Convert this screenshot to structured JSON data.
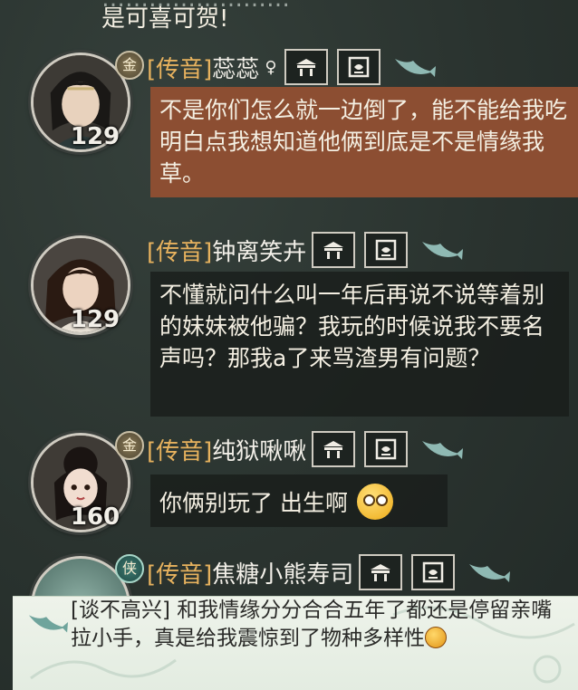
{
  "top_message": {
    "line1": "……………………",
    "line2": "是可喜可贺!"
  },
  "messages": [
    {
      "channel": "[传音]",
      "username": "蕊蕊",
      "gender_icon": "female-symbol",
      "gender_text": "♀",
      "rank_badge": "金",
      "level": "129",
      "text": "不是你们怎么就一边倒了，能不能给我吃明白点我想知道他俩到底是不是情缘我草。",
      "highlighted": true,
      "icons": [
        "house-icon",
        "profile-card-icon",
        "fish-icon"
      ]
    },
    {
      "channel": "[传音]",
      "username": "钟离笑卉",
      "rank_badge": "",
      "level": "129",
      "text": "不懂就问什么叫一年后再说不说等着别的妹妹被他骗？我玩的时候说我不要名声吗？那我a了来骂渣男有问题？",
      "highlighted": false,
      "icons": [
        "house-icon",
        "profile-card-icon",
        "fish-icon"
      ]
    },
    {
      "channel": "[传音]",
      "username": "纯狱啾啾",
      "rank_badge": "金",
      "level": "160",
      "text": "你俩别玩了 出生啊",
      "emoji": "rolling-eyes-emoji",
      "highlighted": false,
      "icons": [
        "house-icon",
        "profile-card-icon",
        "fish-icon"
      ]
    },
    {
      "channel": "[传音]",
      "username": "焦糖小熊寿司",
      "rank_badge": "侠",
      "level": "",
      "highlighted": false,
      "icons": [
        "house-icon",
        "profile-card-icon",
        "fish-icon"
      ]
    }
  ],
  "bottom_preview": {
    "text": "[谈不高兴] 和我情缘分分合合五年了都还是停留亲嘴拉小手，真是给我震惊到了物种多样性",
    "emoji": "angry-face-emoji"
  },
  "colors": {
    "channel": "#e7b25e",
    "highlight_bubble": "#8c4e32",
    "text": "#f4efe2",
    "panel": "#eef3ea"
  }
}
